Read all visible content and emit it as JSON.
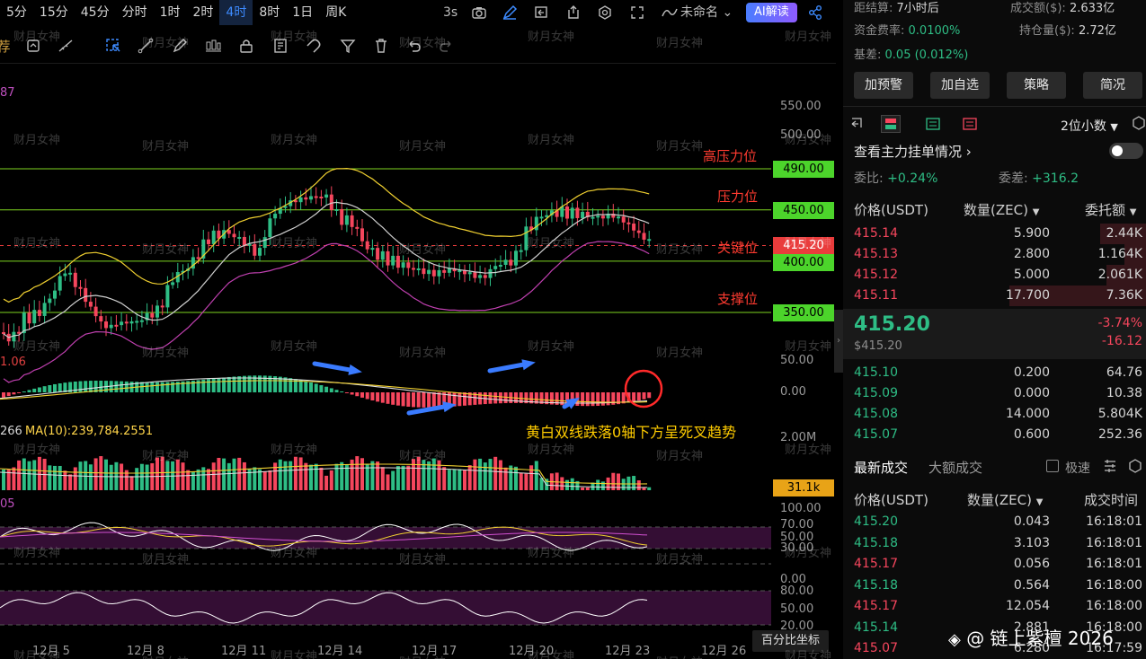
{
  "toolbar": {
    "timeframes": [
      "5分",
      "15分",
      "45分",
      "分时",
      "1时",
      "2时",
      "4时",
      "8时",
      "1日",
      "周K"
    ],
    "active_timeframe": "4时",
    "refresh": "3s",
    "layout_name": "未命名",
    "ai_button": "AI解读"
  },
  "chart": {
    "indicator_truncated_label": "87",
    "macd_truncated_label": "1.06",
    "vol_label_prefix": "266",
    "vol_ma_label": "MA(10):239,784.2551",
    "rsi_truncated_label": "05",
    "levels": [
      {
        "name": "高压力位",
        "price": "490.00"
      },
      {
        "name": "压力位",
        "price": "450.00"
      },
      {
        "name": "关键位",
        "price": "415.20"
      },
      {
        "name": "",
        "price": "400.00"
      },
      {
        "name": "支撑位",
        "price": "350.00"
      }
    ],
    "y_axis_main": [
      "550.00",
      "500.00"
    ],
    "y_axis_macd": [
      "50.00",
      "0.00"
    ],
    "y_axis_vol": [
      "2.00M"
    ],
    "vol_tag": "31.1k",
    "y_axis_rsi": [
      "100.00",
      "70.00",
      "50.00",
      "30.00",
      "0.00"
    ],
    "y_axis_kdj": [
      "80.00",
      "50.00",
      "20.00"
    ],
    "x_axis": [
      "12月 5",
      "12月 8",
      "12月 11",
      "12月 14",
      "12月 17",
      "12月 20",
      "12月 23",
      "12月 26"
    ],
    "annotation": "黄白双线跌落0轴下方呈死叉趋势",
    "pct_button": "百分比坐标",
    "watermark": "财月女神"
  },
  "stats": {
    "settle_label": "距结算:",
    "settle_value": "7小时后",
    "volume_label": "成交额($):",
    "volume_value": "2.633亿",
    "funding_label": "资金费率:",
    "funding_value": "0.0100%",
    "oi_label": "持仓量($):",
    "oi_value": "2.72亿",
    "basis_label": "基差:",
    "basis_value": "0.05 (0.012%)"
  },
  "actions": [
    "加预警",
    "加自选",
    "策略",
    "简况"
  ],
  "orderbook": {
    "precision": "2位小数",
    "main_orders": "查看主力挂单情况",
    "ratio_label": "委比:",
    "ratio_value": "+0.24%",
    "diff_label": "委差:",
    "diff_value": "+316.2",
    "col_price": "价格(USDT)",
    "col_qty": "数量(ZEC)",
    "col_total": "委托额",
    "asks": [
      {
        "price": "415.14",
        "qty": "5.900",
        "total": "2.44K",
        "depth": 0.15
      },
      {
        "price": "415.13",
        "qty": "2.800",
        "total": "1.164K",
        "depth": 0.07
      },
      {
        "price": "415.12",
        "qty": "5.000",
        "total": "2.061K",
        "depth": 0.13
      },
      {
        "price": "415.11",
        "qty": "17.700",
        "total": "7.36K",
        "depth": 0.45
      }
    ],
    "last_price": "415.20",
    "last_price_usd": "$415.20",
    "change_pct": "-3.74%",
    "change_abs": "-16.12",
    "bids": [
      {
        "price": "415.10",
        "qty": "0.200",
        "total": "64.76"
      },
      {
        "price": "415.09",
        "qty": "0.000",
        "total": "10.38"
      },
      {
        "price": "415.08",
        "qty": "14.000",
        "total": "5.804K"
      },
      {
        "price": "415.07",
        "qty": "0.600",
        "total": "252.36"
      }
    ]
  },
  "trades": {
    "tab_latest": "最新成交",
    "tab_large": "大额成交",
    "fast_label": "极速",
    "col_price": "价格(USDT)",
    "col_qty": "数量(ZEC)",
    "col_time": "成交时间",
    "rows": [
      {
        "price": "415.20",
        "qty": "0.043",
        "time": "16:18:01",
        "side": "buy"
      },
      {
        "price": "415.18",
        "qty": "3.103",
        "time": "16:18:01",
        "side": "buy"
      },
      {
        "price": "415.17",
        "qty": "0.056",
        "time": "16:18:01",
        "side": "sell"
      },
      {
        "price": "415.18",
        "qty": "0.564",
        "time": "16:18:00",
        "side": "buy"
      },
      {
        "price": "415.17",
        "qty": "12.054",
        "time": "16:18:00",
        "side": "sell"
      },
      {
        "price": "415.14",
        "qty": "2.881",
        "time": "16:18:00",
        "side": "buy"
      },
      {
        "price": "415.07",
        "qty": "6.280",
        "time": "16:17:59",
        "side": "sell"
      }
    ]
  },
  "footer_watermark": "@ 链上紫檀 2026",
  "colors": {
    "up": "#2ebd85",
    "down": "#f6465d",
    "accent": "#3d8bff",
    "level_line": "#7ed321"
  }
}
